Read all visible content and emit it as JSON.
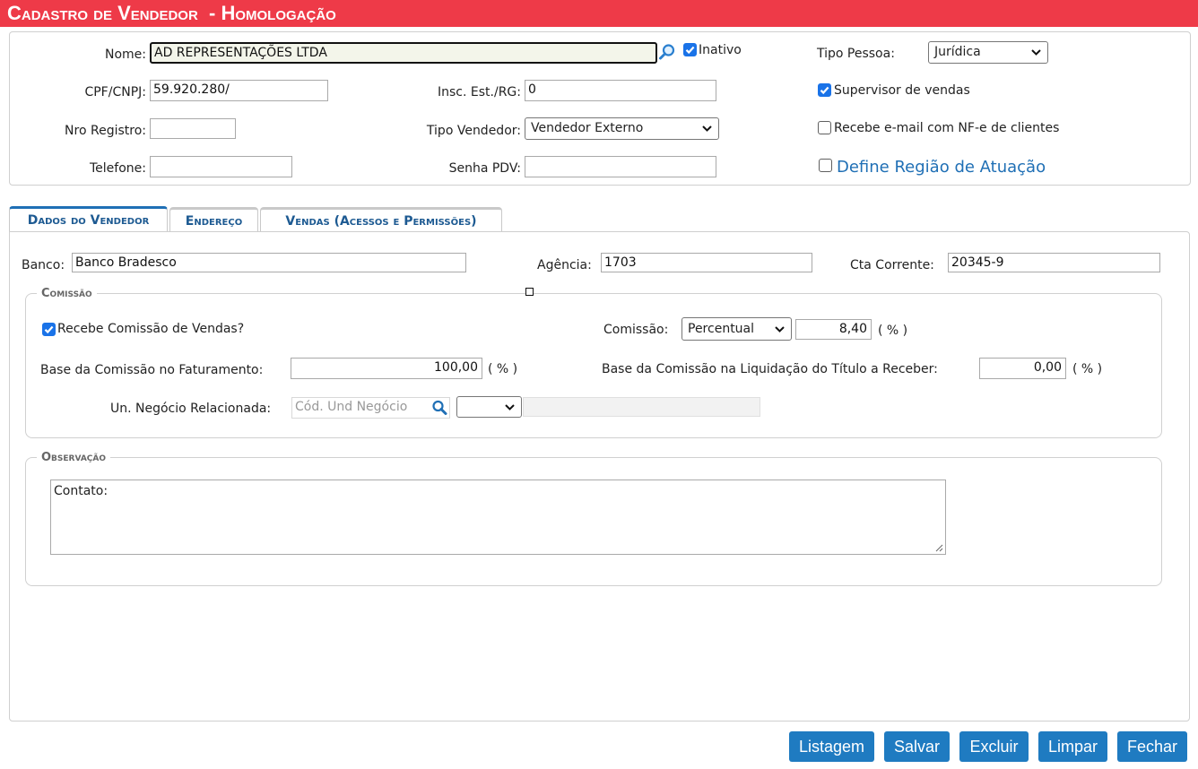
{
  "window": {
    "title": "Cadastro de Vendedor  - Homologação"
  },
  "header_form": {
    "nome_label": "Nome:",
    "nome_value": "AD         REPRESENTAÇÕES LTDA",
    "inativo_label": "Inativo",
    "inativo_checked": true,
    "tipo_pessoa_label": "Tipo Pessoa:",
    "tipo_pessoa_value": "Jurídica",
    "cpf_label": "CPF/CNPJ:",
    "cpf_value": "59.920.280/",
    "insc_label": "Insc. Est./RG:",
    "insc_value": "0",
    "supervisor_label": "Supervisor de vendas",
    "supervisor_checked": true,
    "nro_registro_label": "Nro Registro:",
    "nro_registro_value": "",
    "tipo_vendedor_label": "Tipo Vendedor:",
    "tipo_vendedor_value": "Vendedor Externo",
    "recebe_email_label": "Recebe e-mail com NF-e de clientes",
    "recebe_email_checked": false,
    "telefone_label": "Telefone:",
    "telefone_value": "",
    "senha_pdv_label": "Senha PDV:",
    "senha_pdv_value": "",
    "regiao_label": "Define Região de Atuação",
    "regiao_checked": false
  },
  "tabs": [
    {
      "label": "Dados do Vendedor",
      "active": true
    },
    {
      "label": "Endereço",
      "active": false
    },
    {
      "label": "Vendas (Acessos e Permissões)",
      "active": false
    }
  ],
  "dados": {
    "banco_label": "Banco:",
    "banco_value": "Banco Bradesco",
    "agencia_label": "Agência:",
    "agencia_value": "1703",
    "cta_label": "Cta Corrente:",
    "cta_value": "20345-9"
  },
  "comissao": {
    "legend": "Comissão",
    "recebe_label": "Recebe Comissão de Vendas?",
    "recebe_checked": true,
    "comissao_label": "Comissão:",
    "tipo_value": "Percentual",
    "valor": "8,40",
    "pct_unit": "( % )",
    "base_fat_label": "Base da Comissão no Faturamento:",
    "base_fat_value": "100,00",
    "base_liq_label": "Base da Comissão na Liquidação do Título a Receber:",
    "base_liq_value": "0,00",
    "un_negocio_label": "Un. Negócio Relacionada:",
    "un_negocio_placeholder": "Cód. Und Negócio",
    "un_negocio_select": "",
    "un_negocio_desc": ""
  },
  "observacao": {
    "legend": "Observação",
    "text": "Contato:"
  },
  "buttons": {
    "listagem": "Listagem",
    "salvar": "Salvar",
    "excluir": "Excluir",
    "limpar": "Limpar",
    "fechar": "Fechar"
  },
  "colors": {
    "title_bar": "#ee3a48",
    "accent": "#1f7bc1",
    "checkbox": "#1a73e8"
  }
}
